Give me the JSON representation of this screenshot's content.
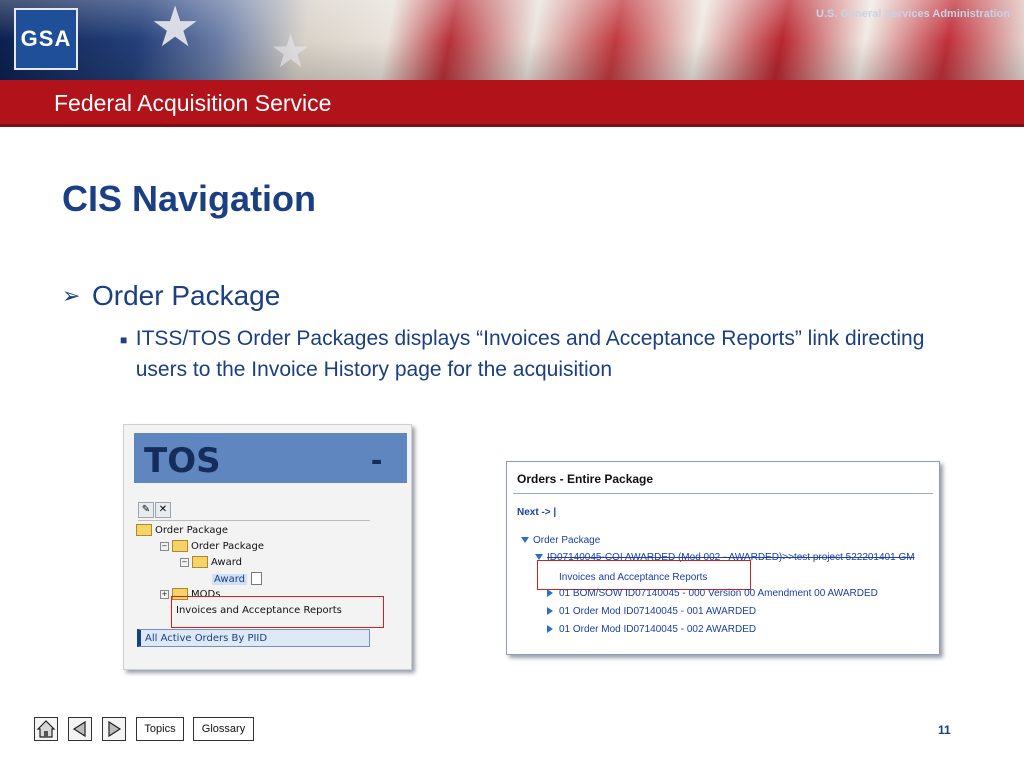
{
  "header": {
    "logo_text": "GSA",
    "agency": "U.S. General Services Administration",
    "service": "Federal Acquisition Service"
  },
  "slide": {
    "title": "CIS Navigation",
    "bullet": "Order Package",
    "sub_bullet": "ITSS/TOS Order Packages displays “Invoices and Acceptance Reports” link directing users to the Invoice History page for the acquisition"
  },
  "left_screenshot": {
    "header": "TOS",
    "header_suffix": "-",
    "toolbar_icons": [
      "edit-icon",
      "delete-icon"
    ],
    "tree": {
      "root": "Order Package",
      "child": "Order Package",
      "grandchild": "Award",
      "selected": "Award",
      "mods": "MODs",
      "invoices_link": "Invoices and Acceptance Reports"
    },
    "active_orders": "All Active Orders By PIID"
  },
  "right_screenshot": {
    "title": "Orders - Entire Package",
    "next_link": "Next -> |",
    "tree_root": "Order Package",
    "order_line": "ID07140045-COI AWARDED (Mod 002 - AWARDED)>>test project 522201401 GM",
    "invoices_link": "Invoices and Acceptance Reports",
    "items": [
      "01 BOM/SOW ID07140045 - 000 Version 00 Amendment 00 AWARDED",
      "01 Order Mod ID07140045 - 001 AWARDED",
      "01 Order Mod ID07140045 - 002 AWARDED"
    ]
  },
  "footer": {
    "home_icon": "home-icon",
    "prev_icon": "prev-arrow-icon",
    "next_icon": "next-arrow-icon",
    "topics": "Topics",
    "glossary": "Glossary",
    "page": "11"
  }
}
